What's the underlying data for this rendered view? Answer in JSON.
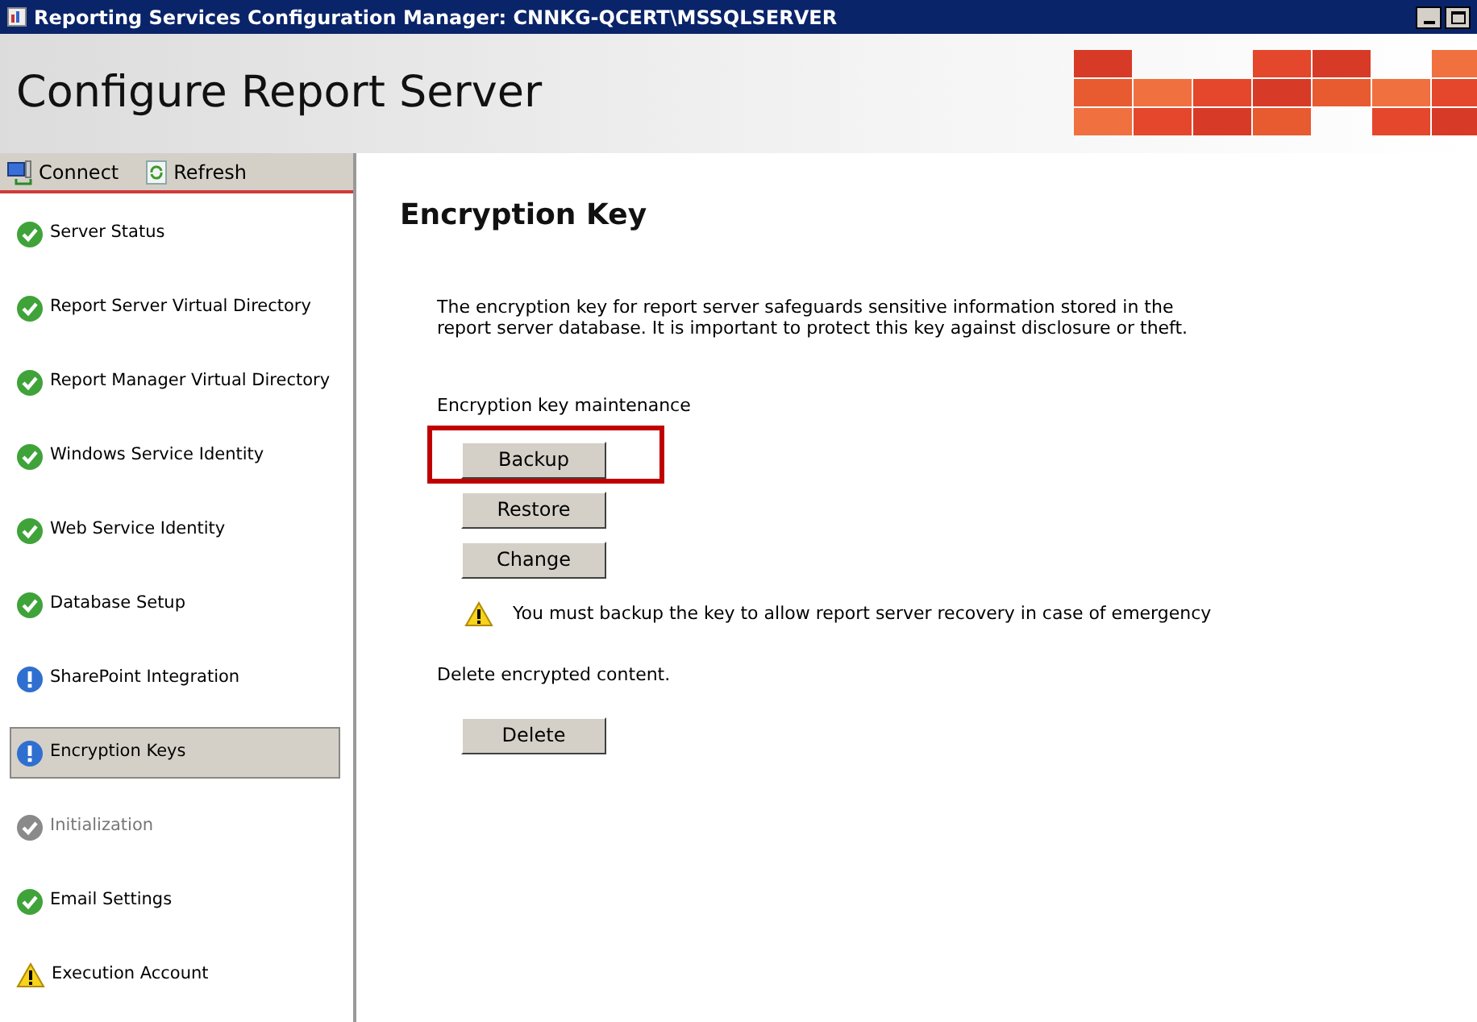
{
  "window": {
    "title": "Reporting Services Configuration Manager: CNNKG-QCERT\\MSSQLSERVER"
  },
  "banner": {
    "title": "Configure Report Server"
  },
  "toolbar": [
    {
      "label": "Connect",
      "kind": "connect"
    },
    {
      "label": "Refresh",
      "kind": "refresh"
    }
  ],
  "sidebar": {
    "items": [
      {
        "label": "Server Status",
        "kind": "ok",
        "selected": false
      },
      {
        "label": "Report Server Virtual Directory",
        "kind": "ok",
        "selected": false
      },
      {
        "label": "Report Manager Virtual Directory",
        "kind": "ok",
        "selected": false
      },
      {
        "label": "Windows Service Identity",
        "kind": "ok",
        "selected": false
      },
      {
        "label": "Web Service Identity",
        "kind": "ok",
        "selected": false
      },
      {
        "label": "Database Setup",
        "kind": "ok",
        "selected": false
      },
      {
        "label": "SharePoint Integration",
        "kind": "info",
        "selected": false
      },
      {
        "label": "Encryption Keys",
        "kind": "info",
        "selected": true
      },
      {
        "label": "Initialization",
        "kind": "disabled",
        "selected": false
      },
      {
        "label": "Email Settings",
        "kind": "ok",
        "selected": false
      },
      {
        "label": "Execution Account",
        "kind": "warning",
        "selected": false
      }
    ]
  },
  "content": {
    "heading": "Encryption Key",
    "description": "The encryption key for report server safeguards sensitive information stored in the report server database. It is important to protect this key against disclosure or theft.",
    "maintenance_label": "Encryption key maintenance",
    "maintenance_buttons": [
      {
        "label": "Backup",
        "highlighted": true
      },
      {
        "label": "Restore",
        "highlighted": false
      },
      {
        "label": "Change",
        "highlighted": false
      }
    ],
    "warning": "You must backup the key to allow report server recovery in case of emergency",
    "delete_label": "Delete encrypted content.",
    "delete_button": {
      "label": "Delete"
    }
  }
}
